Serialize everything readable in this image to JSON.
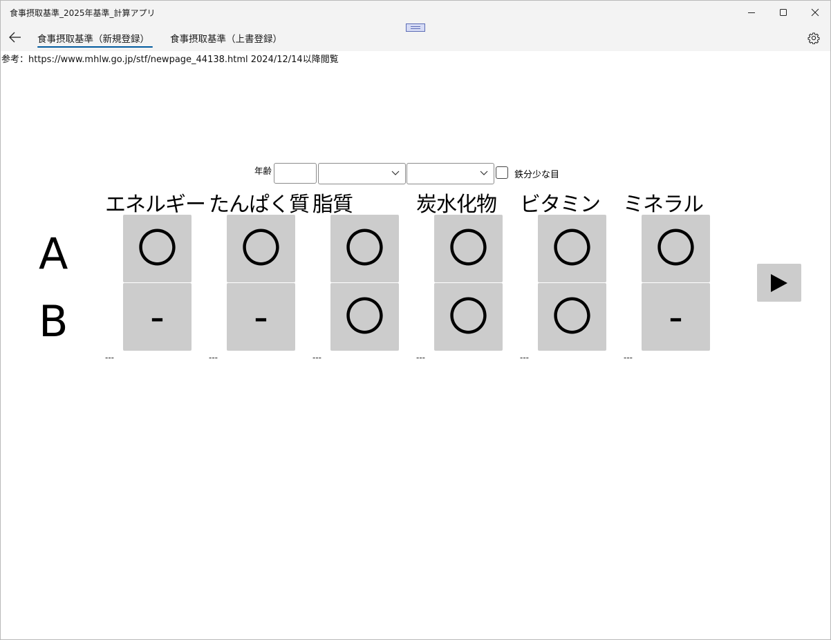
{
  "window": {
    "title": "食事摂取基準_2025年基準_計算アプリ"
  },
  "nav": {
    "tabs": [
      {
        "label": "食事摂取基準（新規登録）",
        "selected": true
      },
      {
        "label": "食事摂取基準（上書登録）",
        "selected": false
      }
    ],
    "back_icon": "back-arrow-icon",
    "settings_icon": "gear-icon"
  },
  "reference": "参考：https://www.mhlw.go.jp/stf/newpage_44138.html 2024/12/14以降閲覧",
  "form": {
    "age_label": "年齢",
    "age_value": "",
    "select1_value": "",
    "select2_value": "",
    "iron_checkbox_label": "鉄分少な目",
    "iron_checked": false
  },
  "grid": {
    "categories": [
      "エネルギー",
      "たんぱく質",
      "脂質",
      "炭水化物",
      "ビタミン",
      "ミネラル"
    ],
    "row_labels": [
      "A",
      "B"
    ],
    "rows": {
      "A": [
        "〇",
        "〇",
        "〇",
        "〇",
        "〇",
        "〇"
      ],
      "B": [
        "-",
        "-",
        "〇",
        "〇",
        "〇",
        "-"
      ]
    },
    "notes": [
      "---",
      "---",
      "---",
      "---",
      "---",
      "---"
    ]
  },
  "play_icon": "play-icon"
}
